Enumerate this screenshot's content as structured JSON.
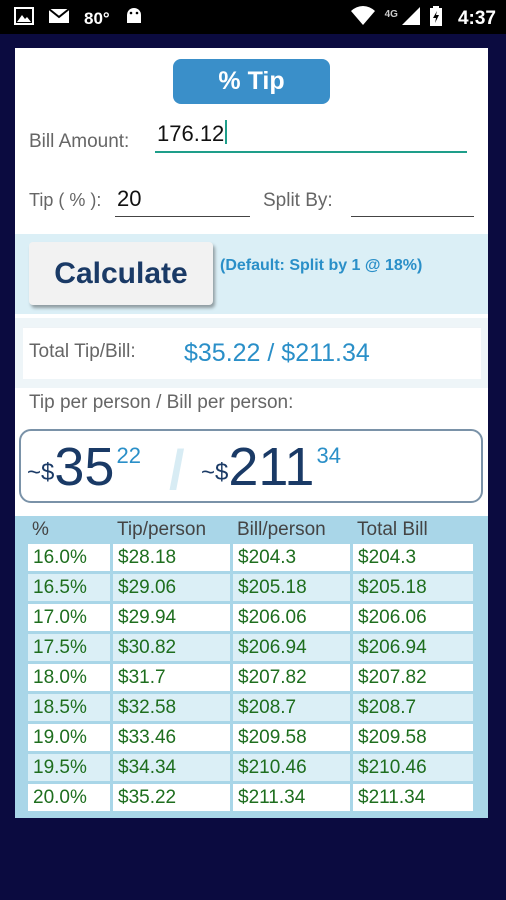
{
  "status_bar": {
    "temperature": "80°",
    "network": "4G",
    "time": "4:37"
  },
  "app": {
    "title_button": "% Tip",
    "bill_amount_label": "Bill Amount:",
    "bill_amount_value": "176.12",
    "tip_label": "Tip ( % ):",
    "tip_value": "20",
    "split_label": "Split By:",
    "split_value": "",
    "calculate_label": "Calculate",
    "default_note": "(Default: Split by 1 @ 18%)",
    "total_label": "Total Tip/Bill:",
    "total_value": "$35.22 / $211.34",
    "per_person_label": "Tip per person / Bill per person:",
    "per_person": {
      "tilde_dollar": "~$",
      "tip_int": "35",
      "tip_cents": "22",
      "bill_int": "211",
      "bill_cents": "34"
    }
  },
  "table": {
    "headers": [
      "%",
      "Tip/person",
      "Bill/person",
      "Total Bill"
    ],
    "rows": [
      [
        "16.0%",
        "$28.18",
        "$204.3",
        "$204.3"
      ],
      [
        "16.5%",
        "$29.06",
        "$205.18",
        "$205.18"
      ],
      [
        "17.0%",
        "$29.94",
        "$206.06",
        "$206.06"
      ],
      [
        "17.5%",
        "$30.82",
        "$206.94",
        "$206.94"
      ],
      [
        "18.0%",
        "$31.7",
        "$207.82",
        "$207.82"
      ],
      [
        "18.5%",
        "$32.58",
        "$208.7",
        "$208.7"
      ],
      [
        "19.0%",
        "$33.46",
        "$209.58",
        "$209.58"
      ],
      [
        "19.5%",
        "$34.34",
        "$210.46",
        "$210.46"
      ],
      [
        "20.0%",
        "$35.22",
        "$211.34",
        "$211.34"
      ]
    ]
  },
  "colors": {
    "accent": "#3a8fc9",
    "highlight_text": "#2a8fc8",
    "big_number": "#1a3a66",
    "table_text": "#1e6e1e",
    "background": "#0b0b40"
  }
}
